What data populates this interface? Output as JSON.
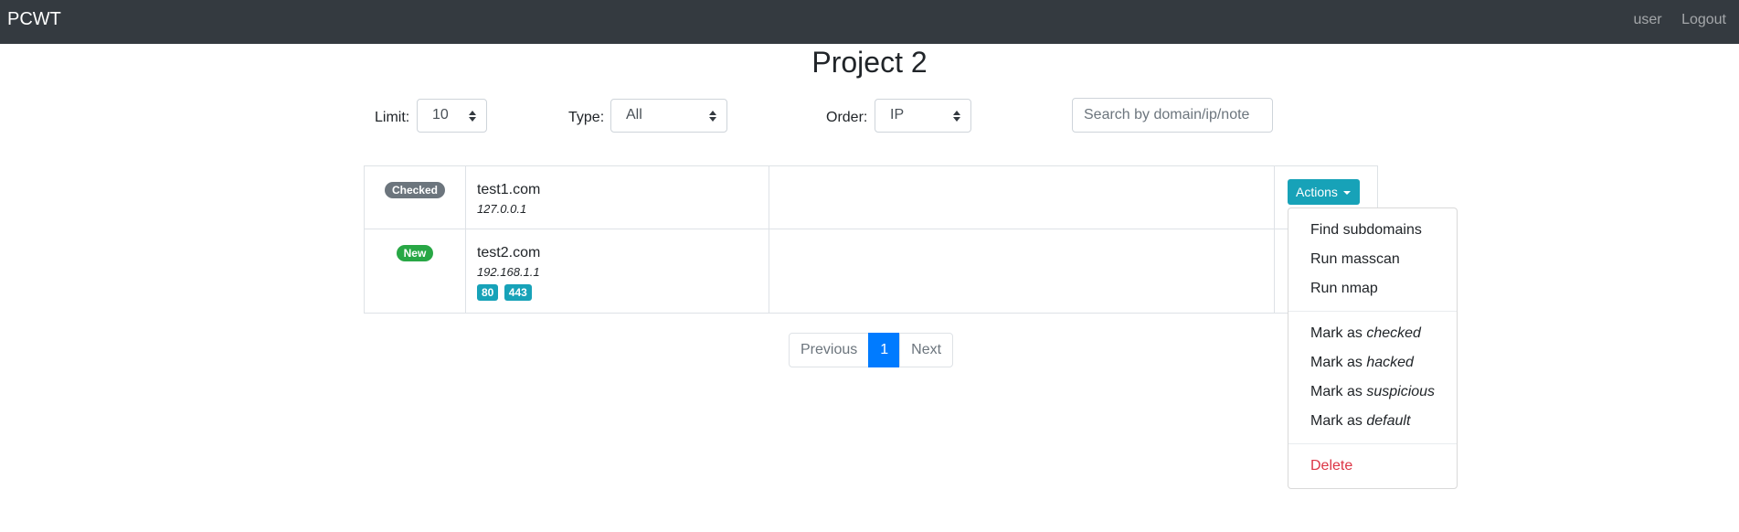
{
  "navbar": {
    "brand": "PCWT",
    "user_link": "user",
    "logout_link": "Logout"
  },
  "page": {
    "title": "Project 2"
  },
  "filters": {
    "limit_label": "Limit:",
    "limit_value": "10",
    "type_label": "Type:",
    "type_value": "All",
    "order_label": "Order:",
    "order_value": "IP",
    "search_placeholder": "Search by domain/ip/note"
  },
  "rows": [
    {
      "status": "Checked",
      "status_color": "#6c757d",
      "domain": "test1.com",
      "ip": "127.0.0.1",
      "ports": []
    },
    {
      "status": "New",
      "status_color": "#28a745",
      "domain": "test2.com",
      "ip": "192.168.1.1",
      "ports": [
        "80",
        "443"
      ]
    }
  ],
  "actions": {
    "button_label": "Actions",
    "menu": {
      "find_subdomains": "Find subdomains",
      "run_masscan": "Run masscan",
      "run_nmap": "Run nmap",
      "mark_as_prefix": "Mark as ",
      "checked": "checked",
      "hacked": "hacked",
      "suspicious": "suspicious",
      "default": "default",
      "delete": "Delete"
    }
  },
  "pagination": {
    "previous": "Previous",
    "current": "1",
    "next": "Next"
  },
  "colors": {
    "navbar": "#343a40",
    "info": "#17a2b8",
    "primary": "#007bff",
    "danger": "#dc3545"
  }
}
